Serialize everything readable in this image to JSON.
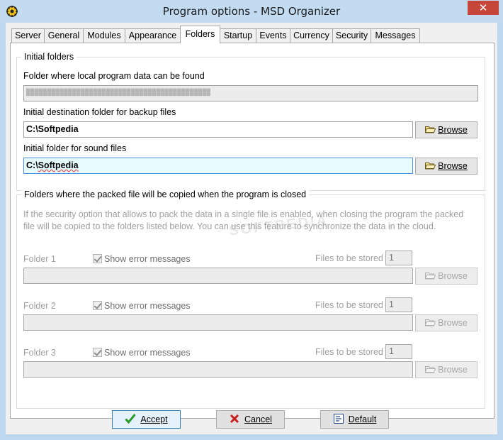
{
  "window": {
    "title": "Program options - MSD Organizer",
    "close_label": "✕"
  },
  "tabs": [
    {
      "label": "Server"
    },
    {
      "label": "General"
    },
    {
      "label": "Modules"
    },
    {
      "label": "Appearance"
    },
    {
      "label": "Folders"
    },
    {
      "label": "Startup"
    },
    {
      "label": "Events"
    },
    {
      "label": "Currency"
    },
    {
      "label": "Security"
    },
    {
      "label": "Messages"
    }
  ],
  "initial_folders": {
    "title": "Initial folders",
    "local_label": "Folder where local program data can be found",
    "local_value": "████████████████████████████████████████████",
    "backup_label": "Initial destination folder for backup files",
    "backup_value": "C:\\Softpedia",
    "sound_label": "Initial folder for sound files",
    "sound_value_prefix": "C:\\",
    "sound_value_word": "Softpedia",
    "browse_label": "Browse"
  },
  "packed": {
    "title": "Folders where the packed file will be copied when the program is closed",
    "description": "If the security option that allows to pack the data in a single file is enabled, when closing the program the packed file will be copied to the folders listed below. You can use this feature to synchronize the data in the cloud.",
    "folders": [
      {
        "label": "Folder 1",
        "show_errors": "Show error messages",
        "files_label": "Files to be stored",
        "files_value": "1",
        "path": "",
        "browse": "Browse"
      },
      {
        "label": "Folder 2",
        "show_errors": "Show error messages",
        "files_label": "Files to be stored",
        "files_value": "1",
        "path": "",
        "browse": "Browse"
      },
      {
        "label": "Folder 3",
        "show_errors": "Show error messages",
        "files_label": "Files to be stored",
        "files_value": "1",
        "path": "",
        "browse": "Browse"
      }
    ]
  },
  "footer": {
    "accept": "Accept",
    "cancel": "Cancel",
    "default": "Default"
  },
  "watermark": "SOFTPEDIA",
  "colors": {
    "focus_field": "#e6fcfd",
    "accept_border": "#3c7fb1",
    "title_bar": "#c2dbf0",
    "close": "#c7463a"
  }
}
